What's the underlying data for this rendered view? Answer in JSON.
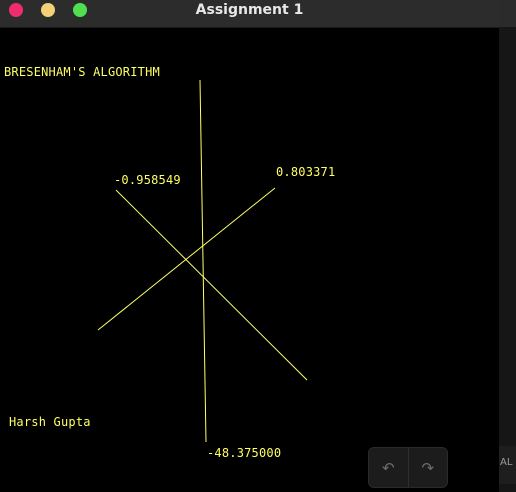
{
  "window": {
    "title": "Assignment 1",
    "traffic_lights": {
      "close": "#ef2d6d",
      "minimize": "#f4d076",
      "maximize": "#4ee04e"
    }
  },
  "canvas": {
    "background": "#000000",
    "stroke_color": "#ffff66",
    "heading": "BRESENHAM'S ALGORITHM",
    "author": "Harsh Gupta",
    "labels": {
      "line1": "-0.958549",
      "line2": "0.803371",
      "line3": "-48.375000"
    }
  },
  "controls": {
    "back_icon": "undo-arrow-icon",
    "forward_icon": "redo-arrow-icon",
    "back_glyph": "↶",
    "forward_glyph": "↷"
  },
  "side_panel": {
    "text": "AL"
  }
}
